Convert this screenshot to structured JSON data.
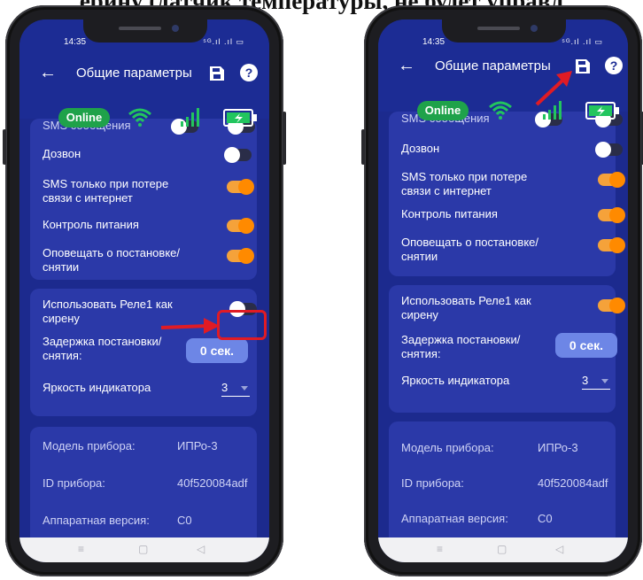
{
  "caption": "ерину (датчик температуры, не будет управл",
  "status_bar": {
    "time": "14:35",
    "icons": "⁵ᴳ.ıl .ıl ▭"
  },
  "header": {
    "title": "Общие параметры",
    "back_icon": "arrow-left",
    "save_icon": "floppy-disk",
    "help_icon": "?"
  },
  "status_row": {
    "online_label": "Online",
    "wifi_color": "#22c55e",
    "battery_color": "#22c55e"
  },
  "settings": {
    "sms_partial": "SMS сообщения",
    "dial": "Дозвон",
    "sms_only_lost": "SMS только при потере связи с интернет",
    "power_control": "Контроль питания",
    "notify_arm": "Оповещать о постановке/снятии",
    "relay_siren": "Использовать Реле1 как сирену",
    "delay_label": "Задержка постановки/снятия:",
    "delay_value": "0 сек.",
    "brightness_label": "Яркость индикатора",
    "brightness_value": "3"
  },
  "device": {
    "model_label": "Модель прибора:",
    "model_value": "ИПРо-3",
    "id_label": "ID прибора:",
    "id_value": "40f520084adf",
    "hw_label": "Аппаратная версия:",
    "hw_value": "C0"
  },
  "toggles_before": {
    "sms": false,
    "dial": false,
    "sms_only_lost": true,
    "power_control": true,
    "notify_arm": true,
    "relay_siren": false
  },
  "toggles_after": {
    "sms": false,
    "dial": false,
    "sms_only_lost": true,
    "power_control": true,
    "notify_arm": true,
    "relay_siren": true
  },
  "navbar": {
    "recents": "≡",
    "home": "▢",
    "back": "◁"
  },
  "accent_colors": {
    "screen_bg": "#1c2a8e",
    "card_bg": "#2b39a8",
    "toggle_on": "#ff8a00",
    "annotation": "#e01b24"
  }
}
